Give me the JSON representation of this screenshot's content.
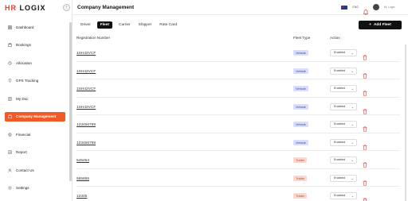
{
  "brand": {
    "logo_text": "LOGIX",
    "logo_prefix": "HR"
  },
  "sidebar": {
    "items": [
      {
        "label": "Dashboard",
        "icon": "grid-icon",
        "active": false
      },
      {
        "label": "Bookings",
        "icon": "briefcase-icon",
        "active": false
      },
      {
        "label": "Allocation",
        "icon": "allocation-icon",
        "active": false
      },
      {
        "label": "GPS Tracking",
        "icon": "gps-icon",
        "active": false
      },
      {
        "label": "My Doc",
        "icon": "document-icon",
        "active": false
      },
      {
        "label": "Company Management",
        "icon": "company-icon",
        "active": true
      },
      {
        "label": "Financial",
        "icon": "financial-icon",
        "active": false
      },
      {
        "label": "Report",
        "icon": "report-icon",
        "active": false
      },
      {
        "label": "Contact Us",
        "icon": "contact-icon",
        "active": false
      },
      {
        "label": "Settings",
        "icon": "settings-icon",
        "active": false
      }
    ]
  },
  "header": {
    "title": "Company Management",
    "language": "ENG",
    "user_name": "Hi, Logix"
  },
  "tabs": [
    {
      "label": "Driver",
      "active": false
    },
    {
      "label": "Fleet",
      "active": true
    },
    {
      "label": "Carrier",
      "active": false
    },
    {
      "label": "Shipper",
      "active": false
    },
    {
      "label": "Rate Card",
      "active": false
    }
  ],
  "add_button": {
    "label": "Add Fleet",
    "icon": "plus-icon"
  },
  "table": {
    "columns": {
      "reg": "Registration Number",
      "type": "Fleet Type",
      "action": "Action"
    },
    "rows": [
      {
        "reg": "1SH42VCF",
        "type": "Vehicle",
        "status": "Enabled"
      },
      {
        "reg": "1SH42VCF",
        "type": "Vehicle",
        "status": "Enabled"
      },
      {
        "reg": "1SH42VCF",
        "type": "Vehicle",
        "status": "Enabled"
      },
      {
        "reg": "1SH42VCF",
        "type": "Vehicle",
        "status": "Enabled"
      },
      {
        "reg": "123456789",
        "type": "Vehicle",
        "status": "Enabled"
      },
      {
        "reg": "123456789",
        "type": "Vehicle",
        "status": "Enabled"
      },
      {
        "reg": "545454",
        "type": "Trailer",
        "status": "Enabled"
      },
      {
        "reg": "565655",
        "type": "Trailer",
        "status": "Enabled"
      },
      {
        "reg": "12345",
        "type": "Trailer",
        "status": "Enabled"
      }
    ]
  },
  "colors": {
    "accent": "#f05a28",
    "vehicle_badge": "#d9defc",
    "trailer_badge": "#fbd8cf",
    "delete": "#e53d2f"
  }
}
